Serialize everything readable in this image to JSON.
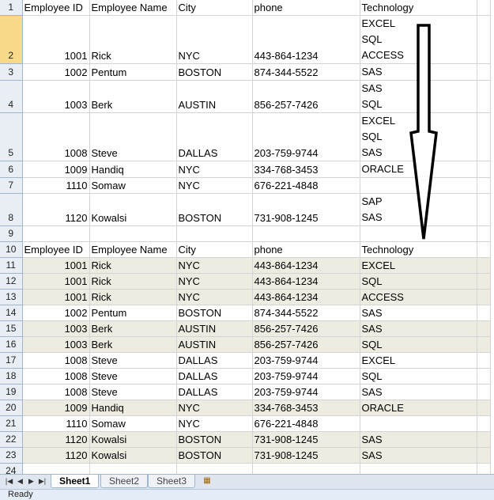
{
  "header": {
    "row": "1",
    "employee_id": "Employee ID",
    "employee_name": "Employee Name",
    "city": "City",
    "phone": "phone",
    "technology": "Technology"
  },
  "top_rows": [
    {
      "row": "2",
      "id": "1001",
      "name": "Rick",
      "city": "NYC",
      "phone": "443-864-1234",
      "tech": [
        "EXCEL",
        "SQL",
        "ACCESS"
      ]
    },
    {
      "row": "3",
      "id": "1002",
      "name": "Pentum",
      "city": "BOSTON",
      "phone": "874-344-5522",
      "tech": [
        "SAS"
      ]
    },
    {
      "row": "4",
      "id": "1003",
      "name": "Berk",
      "city": "AUSTIN",
      "phone": "856-257-7426",
      "tech": [
        "SAS",
        "SQL"
      ]
    },
    {
      "row": "5",
      "id": "1008",
      "name": "Steve",
      "city": "DALLAS",
      "phone": "203-759-9744",
      "tech": [
        "EXCEL",
        "SQL",
        "SAS"
      ]
    },
    {
      "row": "6",
      "id": "1009",
      "name": "Handiq",
      "city": "NYC",
      "phone": "334-768-3453",
      "tech": [
        "ORACLE"
      ]
    },
    {
      "row": "7",
      "id": "1110",
      "name": "Somaw",
      "city": "NYC",
      "phone": "676-221-4848",
      "tech": []
    },
    {
      "row": "8",
      "id": "1120",
      "name": "Kowalsi",
      "city": "BOSTON",
      "phone": "731-908-1245",
      "tech": [
        "SAP",
        "SAS"
      ]
    }
  ],
  "empty_row_9": "9",
  "header2": {
    "row": "10",
    "employee_id": "Employee ID",
    "employee_name": "Employee Name",
    "city": "City",
    "phone": "phone",
    "technology": "Technology"
  },
  "bottom_rows": [
    {
      "row": "11",
      "id": "1001",
      "name": "Rick",
      "city": "NYC",
      "phone": "443-864-1234",
      "tech": "EXCEL"
    },
    {
      "row": "12",
      "id": "1001",
      "name": "Rick",
      "city": "NYC",
      "phone": "443-864-1234",
      "tech": "SQL"
    },
    {
      "row": "13",
      "id": "1001",
      "name": "Rick",
      "city": "NYC",
      "phone": "443-864-1234",
      "tech": "ACCESS"
    },
    {
      "row": "14",
      "id": "1002",
      "name": "Pentum",
      "city": "BOSTON",
      "phone": "874-344-5522",
      "tech": "SAS"
    },
    {
      "row": "15",
      "id": "1003",
      "name": "Berk",
      "city": "AUSTIN",
      "phone": "856-257-7426",
      "tech": "SAS"
    },
    {
      "row": "16",
      "id": "1003",
      "name": "Berk",
      "city": "AUSTIN",
      "phone": "856-257-7426",
      "tech": "SQL"
    },
    {
      "row": "17",
      "id": "1008",
      "name": "Steve",
      "city": "DALLAS",
      "phone": "203-759-9744",
      "tech": "EXCEL"
    },
    {
      "row": "18",
      "id": "1008",
      "name": "Steve",
      "city": "DALLAS",
      "phone": "203-759-9744",
      "tech": "SQL"
    },
    {
      "row": "19",
      "id": "1008",
      "name": "Steve",
      "city": "DALLAS",
      "phone": "203-759-9744",
      "tech": "SAS"
    },
    {
      "row": "20",
      "id": "1009",
      "name": "Handiq",
      "city": "NYC",
      "phone": "334-768-3453",
      "tech": "ORACLE"
    },
    {
      "row": "21",
      "id": "1110",
      "name": "Somaw",
      "city": "NYC",
      "phone": "676-221-4848",
      "tech": ""
    },
    {
      "row": "22",
      "id": "1120",
      "name": "Kowalsi",
      "city": "BOSTON",
      "phone": "731-908-1245",
      "tech": "SAS"
    },
    {
      "row": "23",
      "id": "1120",
      "name": "Kowalsi",
      "city": "BOSTON",
      "phone": "731-908-1245",
      "tech": "SAS"
    }
  ],
  "empty_row_24": "24",
  "tabs": {
    "sheet1": "Sheet1",
    "sheet2": "Sheet2",
    "sheet3": "Sheet3"
  },
  "status": {
    "ready": "Ready"
  },
  "colors": {
    "row_header_bg": "#e9eef5",
    "selected_row_header": "#f9d98a",
    "shaded_row": "#eeece1",
    "gridline": "#d4d4d4"
  }
}
